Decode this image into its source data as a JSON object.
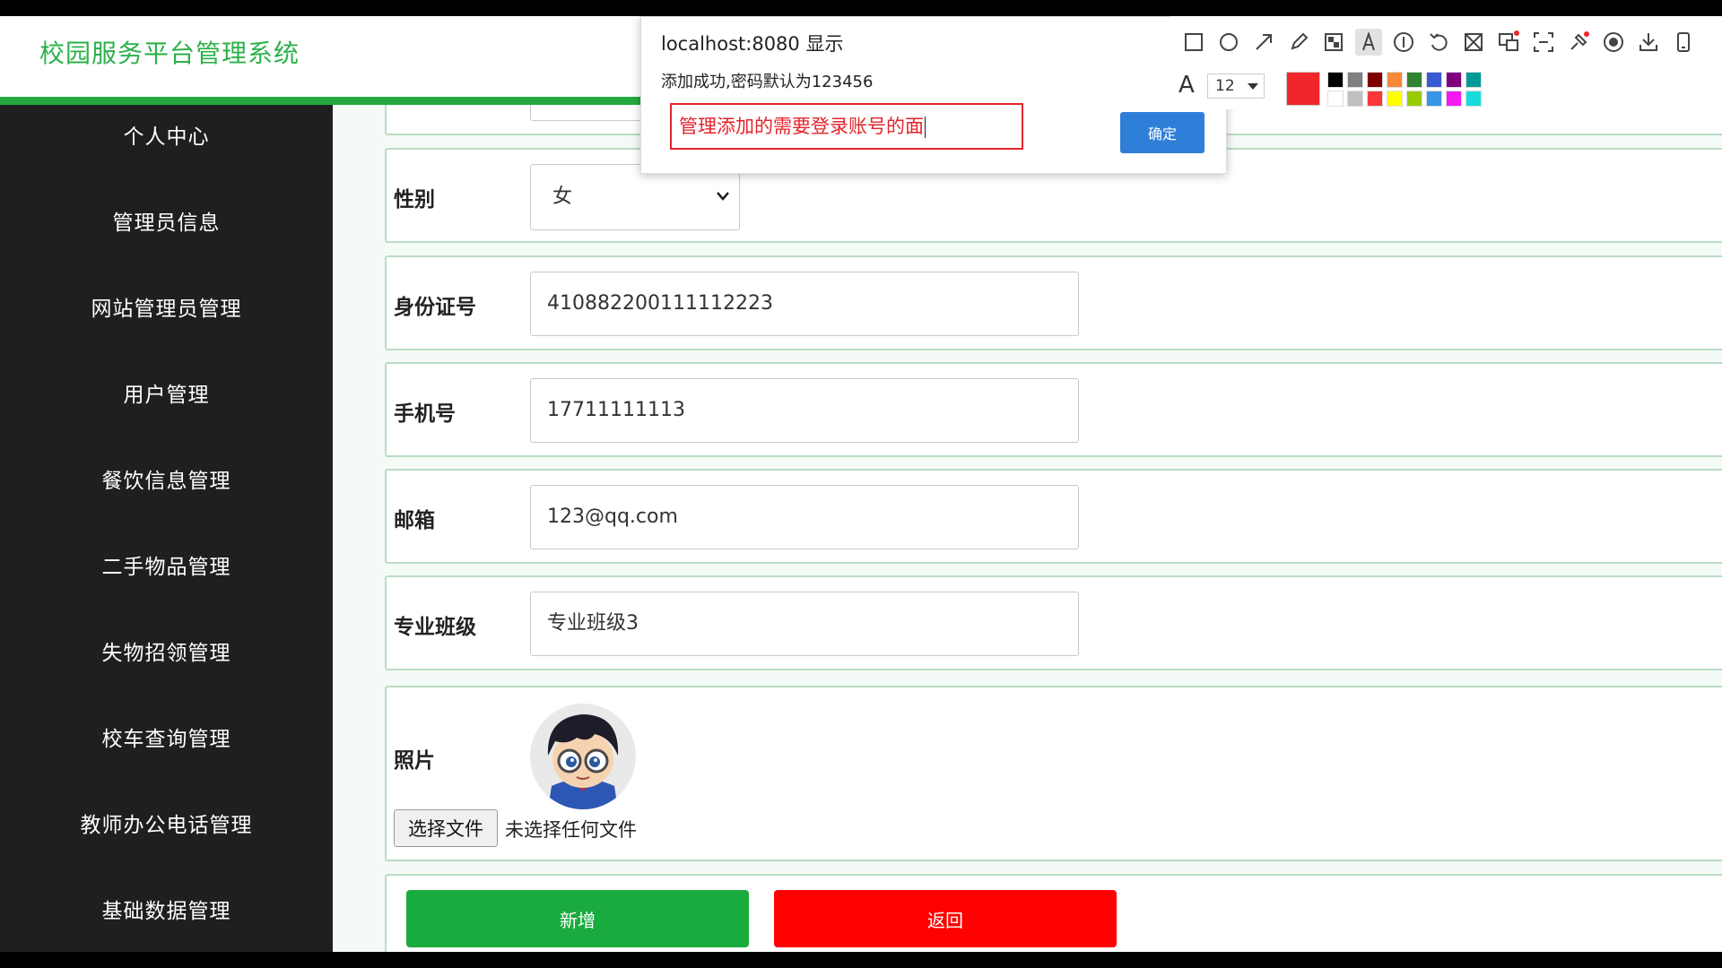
{
  "app": {
    "title": "校园服务平台管理系统"
  },
  "sidebar": {
    "items": [
      {
        "label": "个人中心",
        "name": "personal-center"
      },
      {
        "label": "管理员信息",
        "name": "admin-info"
      },
      {
        "label": "网站管理员管理",
        "name": "site-admin-management"
      },
      {
        "label": "用户管理",
        "name": "user-management"
      },
      {
        "label": "餐饮信息管理",
        "name": "dining-info-management"
      },
      {
        "label": "二手物品管理",
        "name": "secondhand-goods-management"
      },
      {
        "label": "失物招领管理",
        "name": "lost-and-found-management"
      },
      {
        "label": "校车查询管理",
        "name": "school-bus-management"
      },
      {
        "label": "教师办公电话管理",
        "name": "teacher-phone-management"
      },
      {
        "label": "基础数据管理",
        "name": "basic-data-management"
      }
    ]
  },
  "form": {
    "gender": {
      "label": "性别",
      "value": "女"
    },
    "id_number": {
      "label": "身份证号",
      "value": "410882200111112223"
    },
    "phone": {
      "label": "手机号",
      "value": "17711111113"
    },
    "email": {
      "label": "邮箱",
      "value": "123@qq.com"
    },
    "major_class": {
      "label": "专业班级",
      "value": "专业班级3"
    },
    "photo": {
      "label": "照片",
      "file_button": "选择文件",
      "file_status": "未选择任何文件"
    },
    "buttons": {
      "add": "新增",
      "back": "返回"
    }
  },
  "dialog": {
    "origin": "localhost:8080 显示",
    "message": "添加成功,密码默认为123456",
    "annotation_text": "管理添加的需要登录账号的面",
    "ok": "确定"
  },
  "annotation_toolbar": {
    "tools": [
      "rectangle-icon",
      "ellipse-icon",
      "arrow-icon",
      "pencil-icon",
      "mosaic-icon",
      "text-icon",
      "number-icon",
      "undo-icon",
      "cut-icon",
      "translate-icon",
      "ocr-icon",
      "pin-icon",
      "record-icon",
      "download-icon",
      "mobile-icon"
    ],
    "active_tool": "text-icon",
    "font_size": "12",
    "current_color": "#f0262b",
    "palette": [
      "#000000",
      "#808080",
      "#800000",
      "#f7883a",
      "#308430",
      "#385ad3",
      "#800080",
      "#009999",
      "#ffffff",
      "#c0c0c0",
      "#fb3838",
      "#ffff00",
      "#99cc00",
      "#3894e4",
      "#f31bf3",
      "#16dcdc"
    ]
  },
  "colors": {
    "brand_green": "#23a840",
    "title_green": "#2bb14a",
    "sidebar_bg": "#1f1f1f",
    "add_button": "#1aab3e",
    "back_button": "#ff0000",
    "dialog_ok": "#2f7fd9"
  }
}
